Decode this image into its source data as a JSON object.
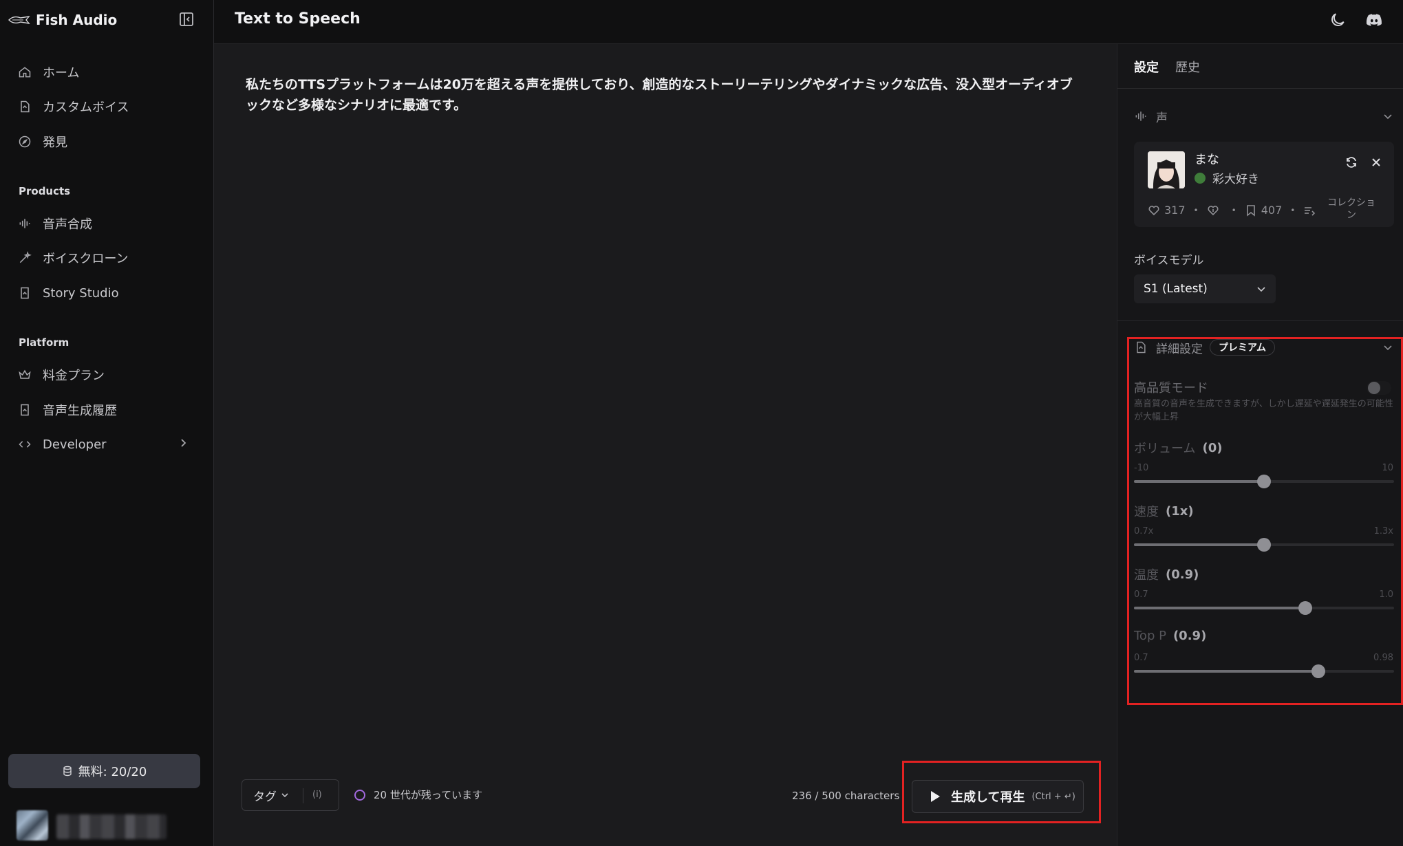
{
  "sidebar": {
    "brand": "Fish Audio",
    "nav": [
      {
        "label": "ホーム",
        "icon": "home-icon"
      },
      {
        "label": "カスタムボイス",
        "icon": "document-icon"
      },
      {
        "label": "発見",
        "icon": "compass-icon"
      }
    ],
    "products_label": "Products",
    "products": [
      {
        "label": "音声合成",
        "icon": "waveform-icon"
      },
      {
        "label": "ボイスクローン",
        "icon": "magic-wand-icon"
      },
      {
        "label": "Story Studio",
        "icon": "book-icon"
      }
    ],
    "platform_label": "Platform",
    "platform": [
      {
        "label": "料金プラン",
        "icon": "crown-icon"
      },
      {
        "label": "音声生成履歴",
        "icon": "history-icon"
      },
      {
        "label": "Developer",
        "icon": "code-icon"
      }
    ],
    "credits": "無料: 20/20"
  },
  "header": {
    "title": "Text to Speech"
  },
  "editor": {
    "text": "私たちのTTSプラットフォームは20万を超える声を提供しており、創造的なストーリーテリングやダイナミックな広告、没入型オーディオブックなど多様なシナリオに最適です。",
    "tag_label": "タグ",
    "tag_info": "(i)",
    "generations_left": "20 世代が残っています",
    "char_count": "236 / 500 characters",
    "play_label": "生成して再生",
    "play_shortcut": "(Ctrl + ↵)"
  },
  "panel": {
    "tabs": [
      "設定",
      "歴史"
    ],
    "voice_section": "声",
    "voice": {
      "name": "まな",
      "author": "彩大好き",
      "likes": "317",
      "bookmarks": "407",
      "collection": "コレクション"
    },
    "model_label": "ボイスモデル",
    "model_value": "S1 (Latest)",
    "advanced_label": "詳細設定",
    "advanced_badge": "プレミアム",
    "hq_label": "高品質モード",
    "hq_desc": "高音質の音声を生成できますが、しかし遅延や遅延発生の可能性が大幅上昇",
    "sliders": [
      {
        "label": "ボリューム",
        "value": "(0)",
        "min": "-10",
        "max": "10",
        "fraction": 0.5
      },
      {
        "label": "速度",
        "value": "(1x)",
        "min": "0.7x",
        "max": "1.3x",
        "fraction": 0.5
      },
      {
        "label": "温度",
        "value": "(0.9)",
        "min": "0.7",
        "max": "1.0",
        "fraction": 0.66
      },
      {
        "label": "Top P",
        "value": "(0.9)",
        "min": "0.7",
        "max": "0.98",
        "fraction": 0.71
      }
    ]
  },
  "colors": {
    "accent_purple": "#a46ae0",
    "highlight_red": "#e32222"
  }
}
